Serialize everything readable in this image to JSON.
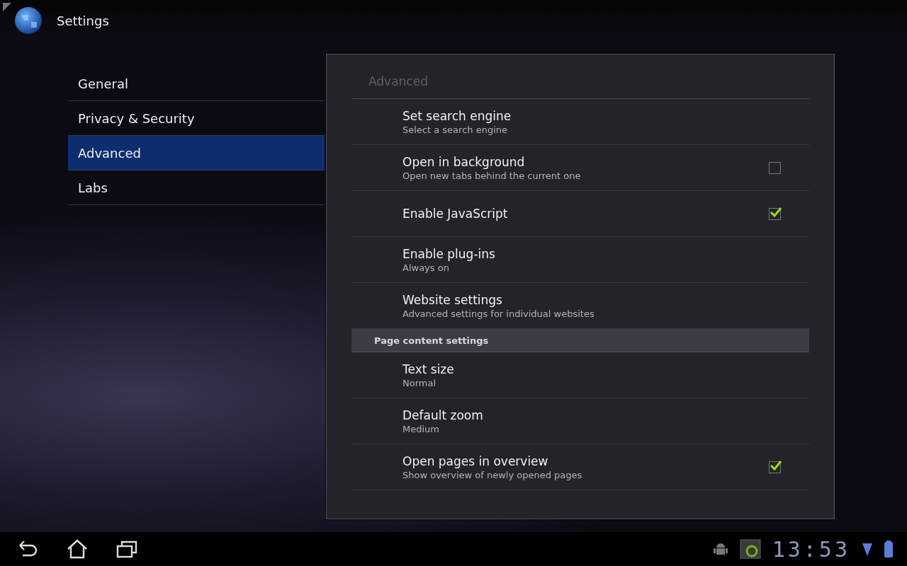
{
  "app_bar": {
    "title": "Settings"
  },
  "sidebar": {
    "items": [
      {
        "label": "General",
        "selected": false
      },
      {
        "label": "Privacy & Security",
        "selected": false
      },
      {
        "label": "Advanced",
        "selected": true
      },
      {
        "label": "Labs",
        "selected": false
      }
    ]
  },
  "panel": {
    "title": "Advanced",
    "rows": [
      {
        "kind": "plain",
        "title": "Set search engine",
        "summary": "Select a search engine"
      },
      {
        "kind": "checkbox",
        "title": "Open in background",
        "summary": "Open new tabs behind the current one",
        "checked": false
      },
      {
        "kind": "checkbox",
        "title": "Enable JavaScript",
        "checked": true
      },
      {
        "kind": "plain",
        "title": "Enable plug-ins",
        "summary": "Always on"
      },
      {
        "kind": "plain",
        "title": "Website settings",
        "summary": "Advanced settings for individual websites"
      },
      {
        "kind": "header",
        "title": "Page content settings"
      },
      {
        "kind": "plain",
        "title": "Text size",
        "summary": "Normal"
      },
      {
        "kind": "plain",
        "title": "Default zoom",
        "summary": "Medium"
      },
      {
        "kind": "checkbox",
        "title": "Open pages in overview",
        "summary": "Show overview of newly opened pages",
        "checked": true
      }
    ]
  },
  "status_bar": {
    "time": "13:53"
  }
}
